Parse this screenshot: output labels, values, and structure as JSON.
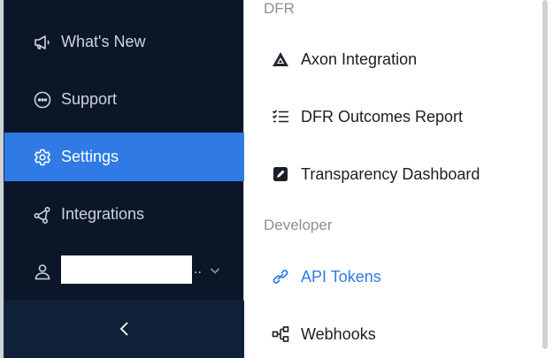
{
  "sidebar": {
    "items": [
      {
        "label": "What's New",
        "icon": "megaphone-icon"
      },
      {
        "label": "Support",
        "icon": "chat-bubble-icon"
      },
      {
        "label": "Settings",
        "icon": "gear-icon",
        "active": true
      },
      {
        "label": "Integrations",
        "icon": "share-nodes-icon"
      }
    ],
    "user": {
      "ellipsis": "..",
      "icon": "user-icon"
    },
    "collapse_icon": "chevron-left-icon"
  },
  "panel": {
    "sections": [
      {
        "title": "DFR",
        "items": [
          {
            "label": "Axon Integration",
            "icon": "axon-logo-icon"
          },
          {
            "label": "DFR Outcomes Report",
            "icon": "checklist-icon"
          },
          {
            "label": "Transparency Dashboard",
            "icon": "edit-square-icon"
          }
        ]
      },
      {
        "title": "Developer",
        "items": [
          {
            "label": "API Tokens",
            "icon": "link-icon",
            "selected": true
          },
          {
            "label": "Webhooks",
            "icon": "webhook-icon"
          }
        ]
      }
    ]
  },
  "colors": {
    "sidebar_bg": "#0b1728",
    "active_bg": "#2f7ae5",
    "link": "#2f7ae5",
    "section_label": "#8a8f96"
  }
}
